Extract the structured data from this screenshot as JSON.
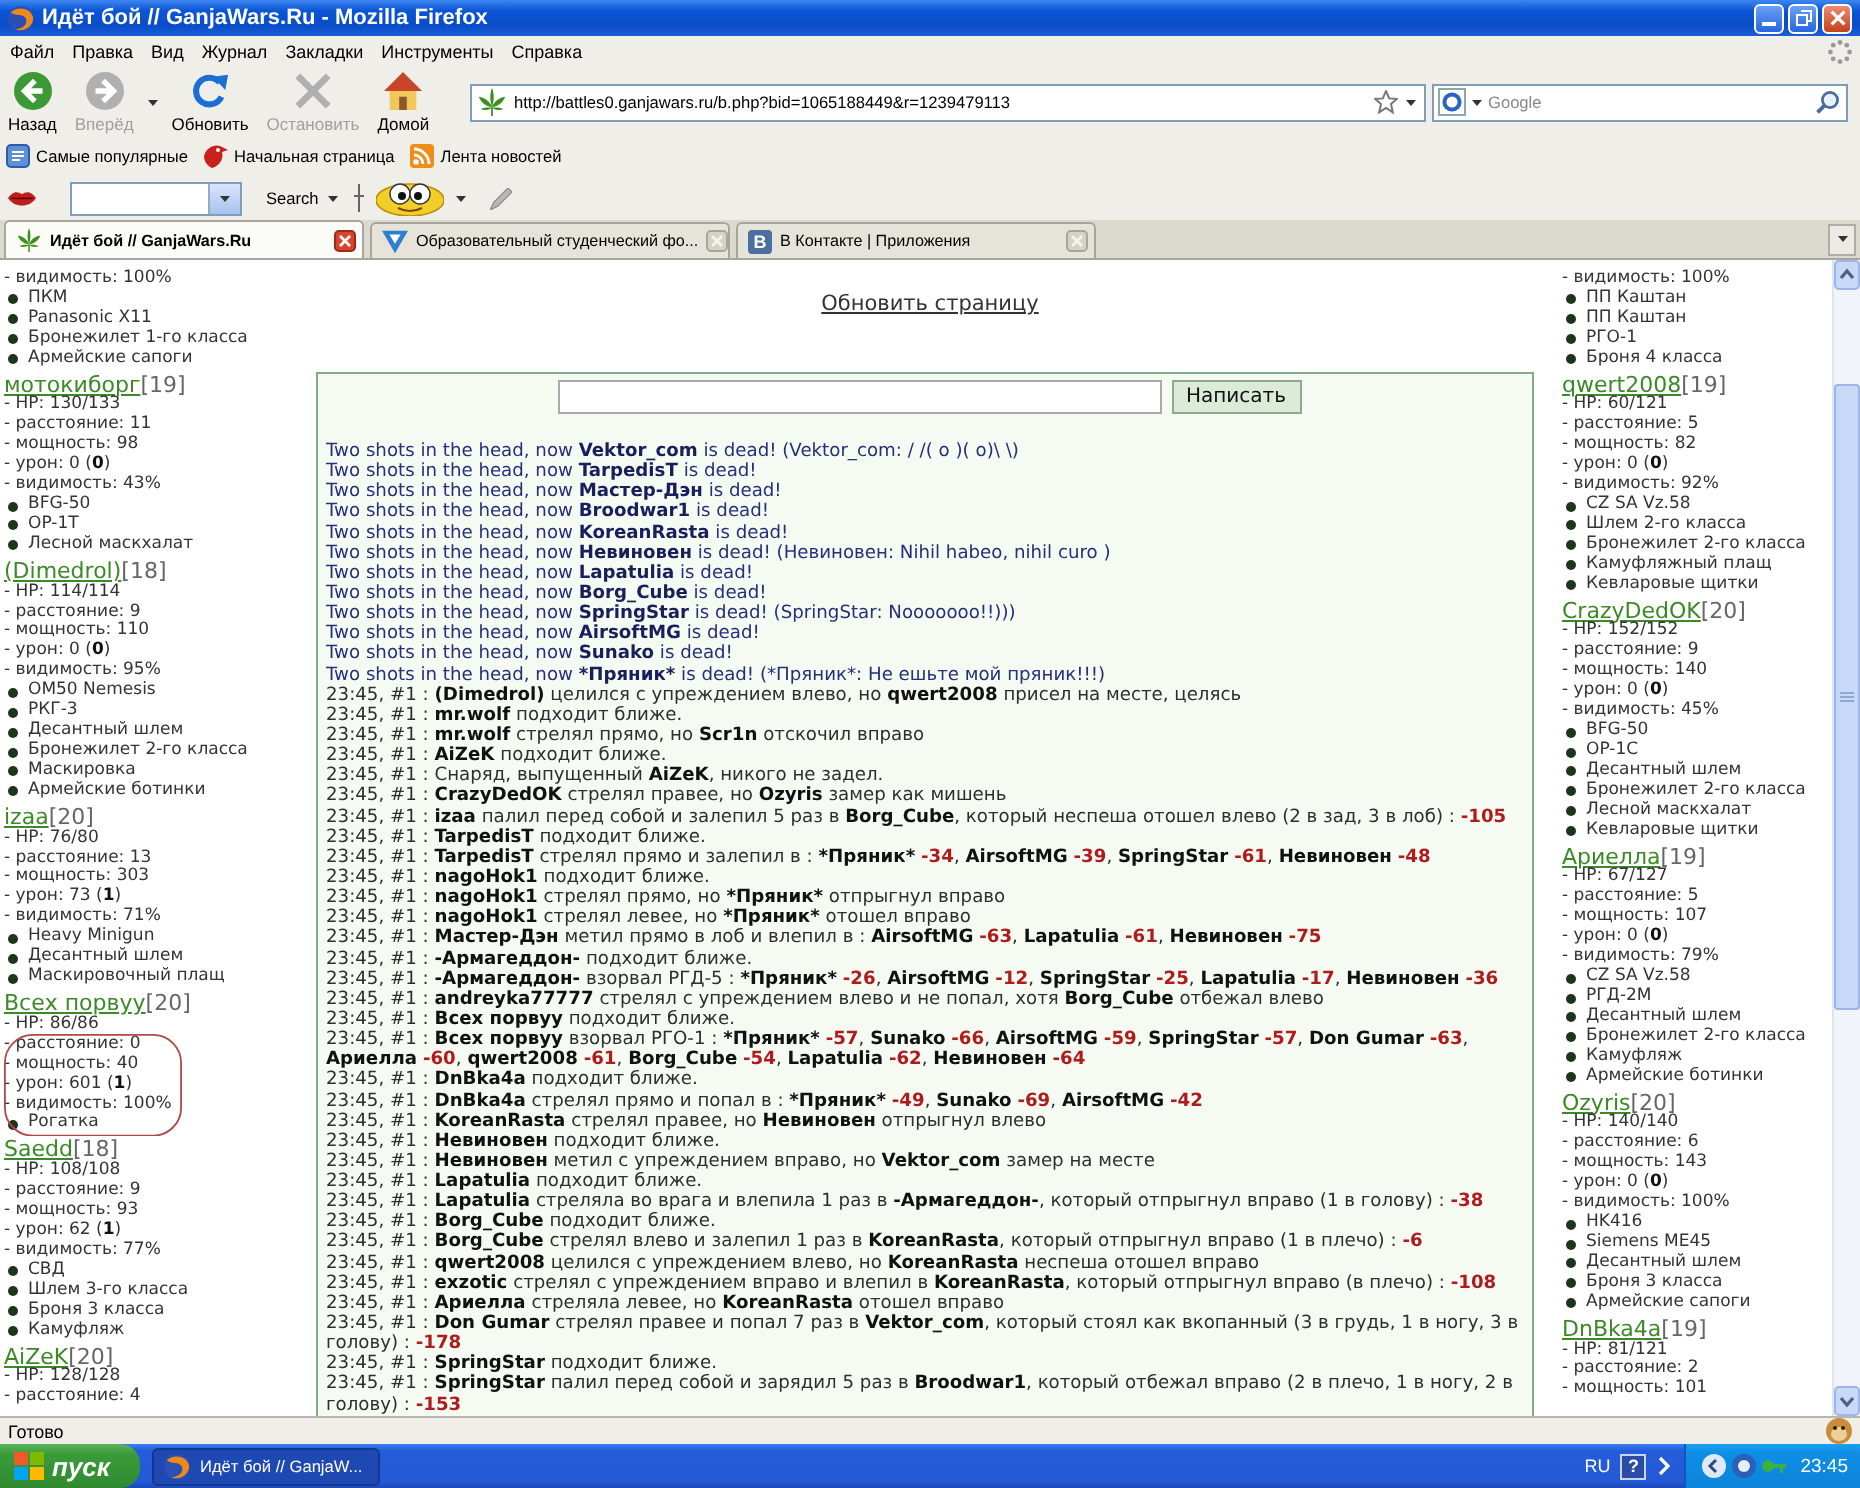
{
  "window": {
    "title": "Идёт бой // GanjaWars.Ru - Mozilla Firefox"
  },
  "menu": [
    "Файл",
    "Правка",
    "Вид",
    "Журнал",
    "Закладки",
    "Инструменты",
    "Справка"
  ],
  "nav_buttons": [
    {
      "kind": "back",
      "label": "Назад",
      "disabled": false
    },
    {
      "kind": "forward",
      "label": "Вперёд",
      "disabled": true
    },
    {
      "kind": "reload",
      "label": "Обновить",
      "disabled": false
    },
    {
      "kind": "stop",
      "label": "Остановить",
      "disabled": true
    },
    {
      "kind": "home",
      "label": "Домой",
      "disabled": false
    }
  ],
  "address_bar": {
    "value": "http://battles0.ganjawars.ru/b.php?bid=1065188449&r=1239479113"
  },
  "search_bar": {
    "placeholder": "Google"
  },
  "bookmarks": [
    {
      "kind": "popular",
      "label": "Самые популярные"
    },
    {
      "kind": "start",
      "label": "Начальная страница"
    },
    {
      "kind": "feed",
      "label": "Лента новостей"
    }
  ],
  "addon_toolbar": {
    "search_label": "Search"
  },
  "tabs": [
    {
      "kind": "leaf",
      "label": "Идёт бой // GanjaWars.Ru",
      "selected": true
    },
    {
      "kind": "forum",
      "label": "Образовательный студенческий фо...",
      "selected": false
    },
    {
      "kind": "social",
      "badge": "В",
      "label": "В Контакте | Приложения",
      "selected": false
    }
  ],
  "page": {
    "refresh_link": "Обновить страницу",
    "send_button": "Написать",
    "left_column": [
      {
        "circled": false,
        "stats": [
          "- видимость: 100%"
        ],
        "items": [
          "ПКМ",
          "Panasonic X11",
          "Бронежилет 1-го класса",
          "Армейские сапоги"
        ]
      },
      {
        "circled": false,
        "name": "мотокиборг",
        "rank": "[19]",
        "stats": [
          "- HP: 130/133",
          "- расстояние: 11",
          "- мощность: 98",
          "- урон: 0 (**0**)",
          "- видимость: 43%"
        ],
        "items": [
          "BFG-50",
          "OP-1T",
          "Лесной маскхалат"
        ]
      },
      {
        "circled": false,
        "name": "(Dimedrol)",
        "rank": "[18]",
        "stats": [
          "- HP: 114/114",
          "- расстояние: 9",
          "- мощность: 110",
          "- урон: 0 (**0**)",
          "- видимость: 95%"
        ],
        "items": [
          "OM50 Nemesis",
          "РКГ-3",
          "Десантный шлем",
          "Бронежилет 2-го класса",
          "Маскировка",
          "Армейские ботинки"
        ]
      },
      {
        "circled": false,
        "name": "izaa",
        "rank": "[20]",
        "stats": [
          "- HP: 76/80",
          "- расстояние: 13",
          "- мощность: 303",
          "- урон: 73 (**1**)",
          "- видимость: 71%"
        ],
        "items": [
          "Heavy Minigun",
          "Десантный шлем",
          "Маскировочный плащ"
        ]
      },
      {
        "circled": true,
        "name": "Всех порвуу",
        "rank": "[20]",
        "stats": [
          "- HP: 86/86",
          "- расстояние: 0",
          "- мощность: 40",
          "- урон: 601 (**1**)",
          "- видимость: 100%"
        ],
        "items": [
          "Рогатка"
        ]
      },
      {
        "circled": false,
        "name": "Saedd",
        "rank": "[18]",
        "stats": [
          "- HP: 108/108",
          "- расстояние: 9",
          "- мощность: 93",
          "- урон: 62 (**1**)",
          "- видимость: 77%"
        ],
        "items": [
          "СВД",
          "Шлем 3-го класса",
          "Броня 3 класса",
          "Камуфляж"
        ]
      },
      {
        "circled": false,
        "name": "AiZeK",
        "rank": "[20]",
        "stats": [
          "- HP: 128/128",
          "- расстояние: 4"
        ]
      }
    ],
    "log": [
      {
        "kind": "death",
        "parts": [
          {
            "kind": "text",
            "text": "Two shots in the head, now "
          },
          {
            "kind": "name",
            "text": "Vektor_com"
          },
          {
            "kind": "text",
            "text": " is dead! (Vektor_com: / /( o )( o)\\ \\)"
          }
        ]
      },
      {
        "kind": "death",
        "parts": [
          {
            "kind": "text",
            "text": "Two shots in the head, now "
          },
          {
            "kind": "name",
            "text": "TarpedisT"
          },
          {
            "kind": "text",
            "text": " is dead!"
          }
        ]
      },
      {
        "kind": "death",
        "parts": [
          {
            "kind": "text",
            "text": "Two shots in the head, now "
          },
          {
            "kind": "name",
            "text": "Мастер-Дэн"
          },
          {
            "kind": "text",
            "text": " is dead!"
          }
        ]
      },
      {
        "kind": "death",
        "parts": [
          {
            "kind": "text",
            "text": "Two shots in the head, now "
          },
          {
            "kind": "name",
            "text": "Broodwar1"
          },
          {
            "kind": "text",
            "text": " is dead!"
          }
        ]
      },
      {
        "kind": "death",
        "parts": [
          {
            "kind": "text",
            "text": "Two shots in the head, now "
          },
          {
            "kind": "name",
            "text": "KoreanRasta"
          },
          {
            "kind": "text",
            "text": " is dead!"
          }
        ]
      },
      {
        "kind": "death",
        "parts": [
          {
            "kind": "text",
            "text": "Two shots in the head, now "
          },
          {
            "kind": "name",
            "text": "Невиновен"
          },
          {
            "kind": "text",
            "text": " is dead! (Невиновен: Nihil habeo, nihil curo )"
          }
        ]
      },
      {
        "kind": "death",
        "parts": [
          {
            "kind": "text",
            "text": "Two shots in the head, now "
          },
          {
            "kind": "name",
            "text": "Lapatulia"
          },
          {
            "kind": "text",
            "text": " is dead!"
          }
        ]
      },
      {
        "kind": "death",
        "parts": [
          {
            "kind": "text",
            "text": "Two shots in the head, now "
          },
          {
            "kind": "name",
            "text": "Borg_Cube"
          },
          {
            "kind": "text",
            "text": " is dead!"
          }
        ]
      },
      {
        "kind": "death",
        "parts": [
          {
            "kind": "text",
            "text": "Two shots in the head, now "
          },
          {
            "kind": "name",
            "text": "SpringStar"
          },
          {
            "kind": "text",
            "text": " is dead! (SpringStar: Nooooooo!!)))"
          }
        ]
      },
      {
        "kind": "death",
        "parts": [
          {
            "kind": "text",
            "text": "Two shots in the head, now "
          },
          {
            "kind": "name",
            "text": "AirsoftMG"
          },
          {
            "kind": "text",
            "text": " is dead!"
          }
        ]
      },
      {
        "kind": "death",
        "parts": [
          {
            "kind": "text",
            "text": "Two shots in the head, now "
          },
          {
            "kind": "name",
            "text": "Sunako"
          },
          {
            "kind": "text",
            "text": " is dead!"
          }
        ]
      },
      {
        "kind": "death",
        "parts": [
          {
            "kind": "text",
            "text": "Two shots in the head, now "
          },
          {
            "kind": "name",
            "text": "*Пряник*"
          },
          {
            "kind": "text",
            "text": " is dead! (*Пряник*: Не ешьте мой пряник!!!)"
          }
        ]
      },
      {
        "kind": "action",
        "time": "23:45, #1 :",
        "parts": [
          {
            "kind": "name",
            "text": "(Dimedrol)"
          },
          {
            "kind": "text",
            "text": " целился с упреждением влево, но "
          },
          {
            "kind": "name",
            "text": "qwert2008"
          },
          {
            "kind": "text",
            "text": " присел на месте, целясь"
          }
        ]
      },
      {
        "kind": "action",
        "time": "23:45, #1 :",
        "parts": [
          {
            "kind": "name",
            "text": "mr.wolf"
          },
          {
            "kind": "text",
            "text": " подходит ближе."
          }
        ]
      },
      {
        "kind": "action",
        "time": "23:45, #1 :",
        "parts": [
          {
            "kind": "name",
            "text": "mr.wolf"
          },
          {
            "kind": "text",
            "text": " стрелял прямо, но "
          },
          {
            "kind": "name",
            "text": "Scr1n"
          },
          {
            "kind": "text",
            "text": " отскочил вправо"
          }
        ]
      },
      {
        "kind": "action",
        "time": "23:45, #1 :",
        "parts": [
          {
            "kind": "name",
            "text": "AiZeK"
          },
          {
            "kind": "text",
            "text": " подходит ближе."
          }
        ]
      },
      {
        "kind": "action",
        "time": "23:45, #1 :",
        "parts": [
          {
            "kind": "text",
            "text": "Снаряд, выпущенный "
          },
          {
            "kind": "name",
            "text": "AiZeK"
          },
          {
            "kind": "text",
            "text": ", никого не задел."
          }
        ]
      },
      {
        "kind": "action",
        "time": "23:45, #1 :",
        "parts": [
          {
            "kind": "name",
            "text": "CrazyDedOK"
          },
          {
            "kind": "text",
            "text": " стрелял правее, но "
          },
          {
            "kind": "name",
            "text": "Ozyris"
          },
          {
            "kind": "text",
            "text": " замер как мишень"
          }
        ]
      },
      {
        "kind": "action",
        "time": "23:45, #1 :",
        "parts": [
          {
            "kind": "name",
            "text": "izaa"
          },
          {
            "kind": "text",
            "text": " палил перед собой и залепил 5 раз в "
          },
          {
            "kind": "name",
            "text": "Borg_Cube"
          },
          {
            "kind": "text",
            "text": ", который неспеша отошел влево (2 в зад, 3 в лоб) : "
          },
          {
            "kind": "damage",
            "text": "-105"
          }
        ]
      },
      {
        "kind": "action",
        "time": "23:45, #1 :",
        "parts": [
          {
            "kind": "name",
            "text": "TarpedisT"
          },
          {
            "kind": "text",
            "text": " подходит ближе."
          }
        ]
      },
      {
        "kind": "action",
        "time": "23:45, #1 :",
        "parts": [
          {
            "kind": "name",
            "text": "TarpedisT"
          },
          {
            "kind": "text",
            "text": " стрелял прямо и залепил в : "
          },
          {
            "kind": "hit",
            "name": "*Пряник*",
            "damage": "-34",
            "separator": ", "
          },
          {
            "kind": "hit",
            "name": "AirsoftMG",
            "damage": "-39",
            "separator": ", "
          },
          {
            "kind": "hit",
            "name": "SpringStar",
            "damage": "-61",
            "separator": ", "
          },
          {
            "kind": "hit",
            "name": "Невиновен",
            "damage": "-48"
          }
        ]
      },
      {
        "kind": "action",
        "time": "23:45, #1 :",
        "parts": [
          {
            "kind": "name",
            "text": "nagoHok1"
          },
          {
            "kind": "text",
            "text": " подходит ближе."
          }
        ]
      },
      {
        "kind": "action",
        "time": "23:45, #1 :",
        "parts": [
          {
            "kind": "name",
            "text": "nagoHok1"
          },
          {
            "kind": "text",
            "text": " стрелял прямо, но "
          },
          {
            "kind": "name",
            "text": "*Пряник*"
          },
          {
            "kind": "text",
            "text": " отпрыгнул вправо"
          }
        ]
      },
      {
        "kind": "action",
        "time": "23:45, #1 :",
        "parts": [
          {
            "kind": "name",
            "text": "nagoHok1"
          },
          {
            "kind": "text",
            "text": " стрелял левее, но "
          },
          {
            "kind": "name",
            "text": "*Пряник*"
          },
          {
            "kind": "text",
            "text": " отошел вправо"
          }
        ]
      },
      {
        "kind": "action",
        "time": "23:45, #1 :",
        "parts": [
          {
            "kind": "name",
            "text": "Мастер-Дэн"
          },
          {
            "kind": "text",
            "text": " метил прямо в лоб и влепил в : "
          },
          {
            "kind": "hit",
            "name": "AirsoftMG",
            "damage": "-63",
            "separator": ", "
          },
          {
            "kind": "hit",
            "name": "Lapatulia",
            "damage": "-61",
            "separator": ", "
          },
          {
            "kind": "hit",
            "name": "Невиновен",
            "damage": "-75"
          }
        ]
      },
      {
        "kind": "action",
        "time": "23:45, #1 :",
        "parts": [
          {
            "kind": "name",
            "text": "-Армагеддон-"
          },
          {
            "kind": "text",
            "text": " подходит ближе."
          }
        ]
      },
      {
        "kind": "action",
        "time": "23:45, #1 :",
        "parts": [
          {
            "kind": "name",
            "text": "-Армагеддон-"
          },
          {
            "kind": "text",
            "text": " взорвал РГД-5 : "
          },
          {
            "kind": "hit",
            "name": "*Пряник*",
            "damage": "-26",
            "separator": ", "
          },
          {
            "kind": "hit",
            "name": "AirsoftMG",
            "damage": "-12",
            "separator": ", "
          },
          {
            "kind": "hit",
            "name": "SpringStar",
            "damage": "-25",
            "separator": ", "
          },
          {
            "kind": "hit",
            "name": "Lapatulia",
            "damage": "-17",
            "separator": ", "
          },
          {
            "kind": "hit",
            "name": "Невиновен",
            "damage": "-36"
          }
        ]
      },
      {
        "kind": "action",
        "time": "23:45, #1 :",
        "parts": [
          {
            "kind": "name",
            "text": "andreyka77777"
          },
          {
            "kind": "text",
            "text": " стрелял с упреждением влево и не попал, хотя "
          },
          {
            "kind": "name",
            "text": "Borg_Cube"
          },
          {
            "kind": "text",
            "text": " отбежал влево"
          }
        ]
      },
      {
        "kind": "action",
        "time": "23:45, #1 :",
        "parts": [
          {
            "kind": "name",
            "text": "Всех порвуу"
          },
          {
            "kind": "text",
            "text": " подходит ближе."
          }
        ]
      },
      {
        "kind": "action",
        "time": "23:45, #1 :",
        "parts": [
          {
            "kind": "name",
            "text": "Всех порвуу"
          },
          {
            "kind": "text",
            "text": " взорвал РГО-1 : "
          },
          {
            "kind": "hit",
            "name": "*Пряник*",
            "damage": "-57",
            "separator": ", "
          },
          {
            "kind": "hit",
            "name": "Sunako",
            "damage": "-66",
            "separator": ", "
          },
          {
            "kind": "hit",
            "name": "AirsoftMG",
            "damage": "-59",
            "separator": ", "
          },
          {
            "kind": "hit",
            "name": "SpringStar",
            "damage": "-57",
            "separator": ", "
          },
          {
            "kind": "hit",
            "name": "Don Gumar",
            "damage": "-63",
            "separator": ", "
          },
          {
            "kind": "hit",
            "name": "Ариелла",
            "damage": "-60",
            "separator": ", "
          },
          {
            "kind": "hit",
            "name": "qwert2008",
            "damage": "-61",
            "separator": ", "
          },
          {
            "kind": "hit",
            "name": "Borg_Cube",
            "damage": "-54",
            "separator": ", "
          },
          {
            "kind": "hit",
            "name": "Lapatulia",
            "damage": "-62",
            "separator": ", "
          },
          {
            "kind": "hit",
            "name": "Невиновен",
            "damage": "-64"
          }
        ]
      },
      {
        "kind": "action",
        "time": "23:45, #1 :",
        "parts": [
          {
            "kind": "name",
            "text": "DnBka4a"
          },
          {
            "kind": "text",
            "text": " подходит ближе."
          }
        ]
      },
      {
        "kind": "action",
        "time": "23:45, #1 :",
        "parts": [
          {
            "kind": "name",
            "text": "DnBka4a"
          },
          {
            "kind": "text",
            "text": " стрелял прямо и попал в : "
          },
          {
            "kind": "hit",
            "name": "*Пряник*",
            "damage": "-49",
            "separator": ", "
          },
          {
            "kind": "hit",
            "name": "Sunako",
            "damage": "-69",
            "separator": ", "
          },
          {
            "kind": "hit",
            "name": "AirsoftMG",
            "damage": "-42"
          }
        ]
      },
      {
        "kind": "action",
        "time": "23:45, #1 :",
        "parts": [
          {
            "kind": "name",
            "text": "KoreanRasta"
          },
          {
            "kind": "text",
            "text": " стрелял правее, но "
          },
          {
            "kind": "name",
            "text": "Невиновен"
          },
          {
            "kind": "text",
            "text": " отпрыгнул влево"
          }
        ]
      },
      {
        "kind": "action",
        "time": "23:45, #1 :",
        "parts": [
          {
            "kind": "name",
            "text": "Невиновен"
          },
          {
            "kind": "text",
            "text": " подходит ближе."
          }
        ]
      },
      {
        "kind": "action",
        "time": "23:45, #1 :",
        "parts": [
          {
            "kind": "name",
            "text": "Невиновен"
          },
          {
            "kind": "text",
            "text": " метил с упреждением вправо, но "
          },
          {
            "kind": "name",
            "text": "Vektor_com"
          },
          {
            "kind": "text",
            "text": " замер на месте"
          }
        ]
      },
      {
        "kind": "action",
        "time": "23:45, #1 :",
        "parts": [
          {
            "kind": "name",
            "text": "Lapatulia"
          },
          {
            "kind": "text",
            "text": " подходит ближе."
          }
        ]
      },
      {
        "kind": "action",
        "time": "23:45, #1 :",
        "parts": [
          {
            "kind": "name",
            "text": "Lapatulia"
          },
          {
            "kind": "text",
            "text": " стреляла во врага и влепила 1 раз в "
          },
          {
            "kind": "name",
            "text": "-Армагеддон-"
          },
          {
            "kind": "text",
            "text": ", который отпрыгнул вправо (1 в голову) : "
          },
          {
            "kind": "damage",
            "text": "-38"
          }
        ]
      },
      {
        "kind": "action",
        "time": "23:45, #1 :",
        "parts": [
          {
            "kind": "name",
            "text": "Borg_Cube"
          },
          {
            "kind": "text",
            "text": " подходит ближе."
          }
        ]
      },
      {
        "kind": "action",
        "time": "23:45, #1 :",
        "parts": [
          {
            "kind": "name",
            "text": "Borg_Cube"
          },
          {
            "kind": "text",
            "text": " стрелял влево и залепил 1 раз в "
          },
          {
            "kind": "name",
            "text": "KoreanRasta"
          },
          {
            "kind": "text",
            "text": ", который отпрыгнул вправо (1 в плечо) : "
          },
          {
            "kind": "damage",
            "text": "-6"
          }
        ]
      },
      {
        "kind": "action",
        "time": "23:45, #1 :",
        "parts": [
          {
            "kind": "name",
            "text": "qwert2008"
          },
          {
            "kind": "text",
            "text": " целился с упреждением влево, но "
          },
          {
            "kind": "name",
            "text": "KoreanRasta"
          },
          {
            "kind": "text",
            "text": " неспеша отошел вправо"
          }
        ]
      },
      {
        "kind": "action",
        "time": "23:45, #1 :",
        "parts": [
          {
            "kind": "name",
            "text": "exzotic"
          },
          {
            "kind": "text",
            "text": " стрелял с упреждением вправо и влепил в "
          },
          {
            "kind": "name",
            "text": "KoreanRasta"
          },
          {
            "kind": "text",
            "text": ", который отпрыгнул вправо (в плечо) : "
          },
          {
            "kind": "damage",
            "text": "-108"
          }
        ]
      },
      {
        "kind": "action",
        "time": "23:45, #1 :",
        "parts": [
          {
            "kind": "name",
            "text": "Ариелла"
          },
          {
            "kind": "text",
            "text": " стреляла левее, но "
          },
          {
            "kind": "name",
            "text": "KoreanRasta"
          },
          {
            "kind": "text",
            "text": " отошел вправо"
          }
        ]
      },
      {
        "kind": "action",
        "time": "23:45, #1 :",
        "parts": [
          {
            "kind": "name",
            "text": "Don Gumar"
          },
          {
            "kind": "text",
            "text": " стрелял правее и попал 7 раз в "
          },
          {
            "kind": "name",
            "text": "Vektor_com"
          },
          {
            "kind": "text",
            "text": ", который стоял как вкопанный (3 в грудь, 1 в ногу, 3 в голову) : "
          },
          {
            "kind": "damage",
            "text": "-178"
          }
        ]
      },
      {
        "kind": "action",
        "time": "23:45, #1 :",
        "parts": [
          {
            "kind": "name",
            "text": "SpringStar"
          },
          {
            "kind": "text",
            "text": " подходит ближе."
          }
        ]
      },
      {
        "kind": "action",
        "time": "23:45, #1 :",
        "parts": [
          {
            "kind": "name",
            "text": "SpringStar"
          },
          {
            "kind": "text",
            "text": " палил перед собой и зарядил 5 раз в "
          },
          {
            "kind": "name",
            "text": "Broodwar1"
          },
          {
            "kind": "text",
            "text": ", который отбежал вправо (2 в плечо, 1 в ногу, 2 в голову) : "
          },
          {
            "kind": "damage",
            "text": "-153"
          }
        ]
      }
    ],
    "right_column": [
      {
        "stats": [
          "- видимость: 100%"
        ],
        "items": [
          "ПП Каштан",
          "ПП Каштан",
          "РГО-1",
          "Броня 4 класса"
        ]
      },
      {
        "name": "qwert2008",
        "rank": "[19]",
        "stats": [
          "- HP: 60/121",
          "- расстояние: 5",
          "- мощность: 82",
          "- урон: 0 (**0**)",
          "- видимость: 92%"
        ],
        "items": [
          "CZ SA Vz.58",
          "Шлем 2-го класса",
          "Бронежилет 2-го класса",
          "Камуфляжный плащ",
          "Кевларовые щитки"
        ]
      },
      {
        "name": "CrazyDedOK",
        "rank": "[20]",
        "stats": [
          "- HP: 152/152",
          "- расстояние: 9",
          "- мощность: 140",
          "- урон: 0 (**0**)",
          "- видимость: 45%"
        ],
        "items": [
          "BFG-50",
          "OP-1C",
          "Десантный шлем",
          "Бронежилет 2-го класса",
          "Лесной маскхалат",
          "Кевларовые щитки"
        ]
      },
      {
        "name": "Ариелла",
        "rank": "[19]",
        "stats": [
          "- HP: 67/127",
          "- расстояние: 5",
          "- мощность: 107",
          "- урон: 0 (**0**)",
          "- видимость: 79%"
        ],
        "items": [
          "CZ SA Vz.58",
          "РГД-2М",
          "Десантный шлем",
          "Бронежилет 2-го класса",
          "Камуфляж",
          "Армейские ботинки"
        ]
      },
      {
        "name": "Ozyris",
        "rank": "[20]",
        "stats": [
          "- HP: 140/140",
          "- расстояние: 6",
          "- мощность: 143",
          "- урон: 0 (**0**)",
          "- видимость: 100%"
        ],
        "items": [
          "HK416",
          "Siemens ME45",
          "Десантный шлем",
          "Броня 3 класса",
          "Армейские сапоги"
        ]
      },
      {
        "name": "DnBka4a",
        "rank": "[19]",
        "stats": [
          "- HP: 81/121",
          "- расстояние: 2",
          "- мощность: 101"
        ]
      }
    ]
  },
  "status_bar": {
    "text": "Готово"
  },
  "taskbar": {
    "start": "пуск",
    "windows": [
      {
        "label": "Идёт бой // GanjaW...",
        "selected": true
      }
    ],
    "language": "RU",
    "help": "?",
    "clock": "23:45"
  }
}
